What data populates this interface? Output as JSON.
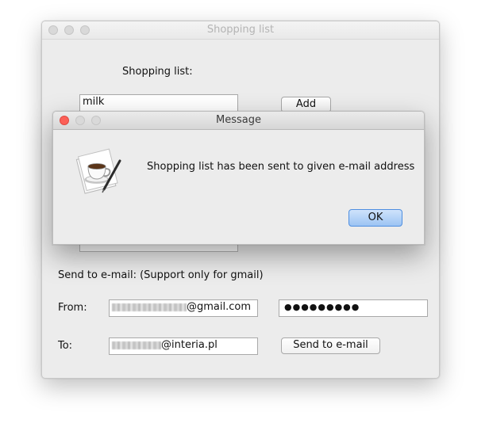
{
  "main_window": {
    "title": "Shopping list",
    "heading": "Shopping list:",
    "item_input_value": "milk",
    "add_button_label": "Add",
    "send_section_label": "Send to e-mail: (Support only for gmail)",
    "from_label": "From:",
    "from_email_suffix": "@gmail.com",
    "password_mask": "●●●●●●●●●",
    "to_label": "To:",
    "to_email_suffix": "@interia.pl",
    "send_button_label": "Send to e-mail"
  },
  "dialog": {
    "title": "Message",
    "message": "Shopping list has been sent to given e-mail address",
    "ok_button_label": "OK",
    "icon": "coffee-cup-icon"
  },
  "colors": {
    "window_bg": "#ececec",
    "close_button": "#fc5f57",
    "default_button": "#9cc4f3"
  }
}
